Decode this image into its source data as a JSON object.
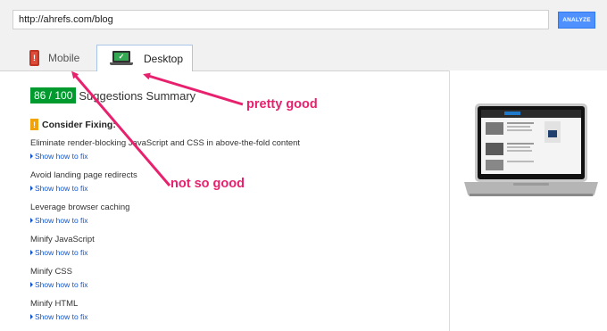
{
  "search": {
    "url_value": "http://ahrefs.com/blog",
    "analyze_label": "ANALYZE"
  },
  "tabs": [
    {
      "label": "Mobile",
      "icon": "mobile-phone-icon",
      "active": false
    },
    {
      "label": "Desktop",
      "icon": "laptop-icon",
      "active": true
    }
  ],
  "summary": {
    "score": "86 / 100",
    "title": "Suggestions Summary",
    "consider_label": "Consider Fixing:",
    "rules": [
      {
        "title": "Eliminate render-blocking JavaScript and CSS in above-the-fold content",
        "link": "Show how to fix"
      },
      {
        "title": "Avoid landing page redirects",
        "link": "Show how to fix"
      },
      {
        "title": "Leverage browser caching",
        "link": "Show how to fix"
      },
      {
        "title": "Minify JavaScript",
        "link": "Show how to fix"
      },
      {
        "title": "Minify CSS",
        "link": "Show how to fix"
      },
      {
        "title": "Minify HTML",
        "link": "Show how to fix"
      }
    ]
  },
  "annotations": {
    "pretty_good": "pretty good",
    "not_so_good": "not so good"
  },
  "colors": {
    "score_green": "#009a2e",
    "warning_orange": "#f0a30a",
    "link_blue": "#1155cc",
    "annotation_pink": "#e8216f",
    "button_blue": "#4d90fe"
  }
}
